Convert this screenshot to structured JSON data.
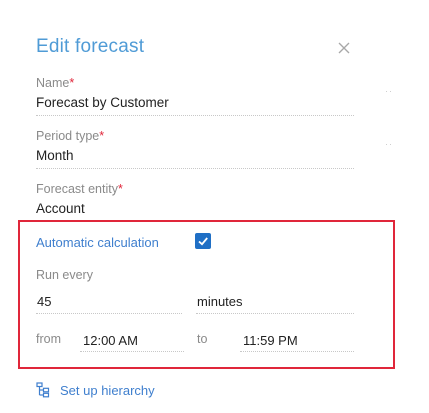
{
  "dialog": {
    "title": "Edit forecast"
  },
  "fields": {
    "name": {
      "label": "Name",
      "required_mark": "*",
      "value": "Forecast by Customer"
    },
    "period_type": {
      "label": "Period type",
      "required_mark": "*",
      "value": "Month"
    },
    "forecast_entity": {
      "label": "Forecast entity",
      "required_mark": "*",
      "value": "Account"
    }
  },
  "auto_calc": {
    "label": "Automatic calculation",
    "checked": true,
    "run_every_label": "Run every",
    "interval_value": "45",
    "interval_unit": "minutes",
    "from_label": "from",
    "from_value": "12:00 AM",
    "to_label": "to",
    "to_value": "11:59 PM"
  },
  "hierarchy": {
    "label": "Set up hierarchy",
    "icon": "hierarchy-icon"
  },
  "colors": {
    "title": "#4f9bd6",
    "link": "#3f7fce",
    "required": "#e0263a",
    "highlight_border": "#e0263a",
    "checkbox": "#1f6fc5"
  }
}
